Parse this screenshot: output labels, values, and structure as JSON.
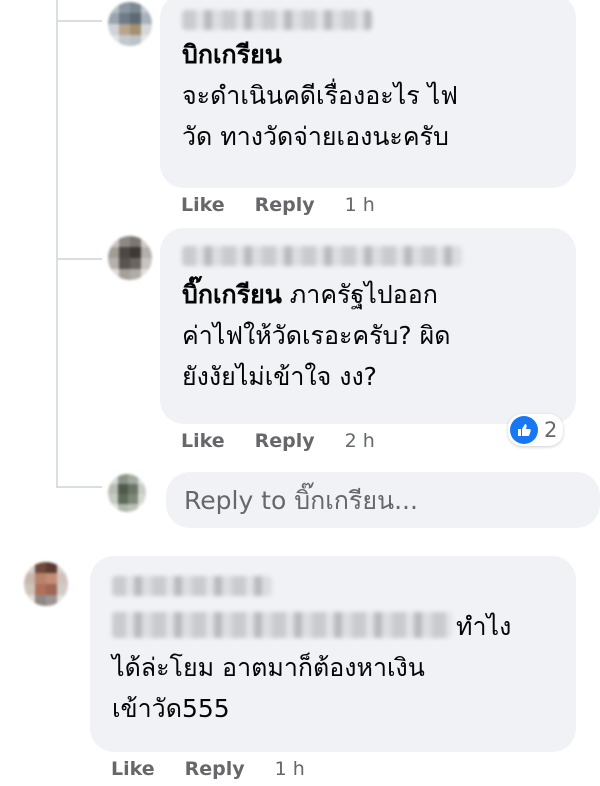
{
  "comments": [
    {
      "author": "",
      "mention": "บิกเกรียน",
      "lines": [
        "จะดำเนินคดีเรื่องอะไร ไฟ",
        "วัด ทางวัดจ่ายเองนะครับ"
      ],
      "like_label": "Like",
      "reply_label": "Reply",
      "time": "1 h"
    },
    {
      "author": "",
      "mention": "บิ๊กเกรียน",
      "lines_first_rest": " ภาครัฐไปออก",
      "lines": [
        "ค่าไฟให้วัดเรอะครับ? ผิด",
        "ยังงัยไม่เข้าใจ งง?"
      ],
      "reaction_count": "2",
      "like_label": "Like",
      "reply_label": "Reply",
      "time": "2 h"
    },
    {
      "author": "",
      "line1_suffix": "ทำไง",
      "lines": [
        "ได้ล่ะโยม อาตมาก็ต้องหาเงิน",
        "เข้าวัด555"
      ],
      "like_label": "Like",
      "reply_label": "Reply",
      "time": "1 h"
    }
  ],
  "reply_box": {
    "placeholder": "Reply to บิ๊กเกรียน..."
  },
  "colors": {
    "bubble": "#f0f2f5",
    "meta_text": "#65676b",
    "like_blue": "#1877f2"
  }
}
